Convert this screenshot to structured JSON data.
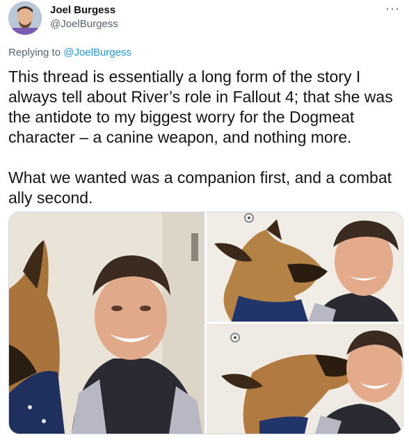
{
  "tweet": {
    "author_name": "Joel Burgess",
    "author_handle": "@JoelBurgess",
    "more_icon": "more-horizontal-icon",
    "reply_prefix": "Replying to",
    "reply_to": "@JoelBurgess",
    "text": "This thread is essentially a long form of the story I always tell about River’s role in Fallout 4; that she was the antidote to my biggest worry for the Dogmeat character – a canine weapon, and nothing more.\n\nWhat we wanted was a companion first, and a combat ally second."
  },
  "media": {
    "photo_count": 3
  },
  "colors": {
    "link": "#1d9bf0",
    "secondary_text": "#536471",
    "border": "#cfd9de"
  }
}
